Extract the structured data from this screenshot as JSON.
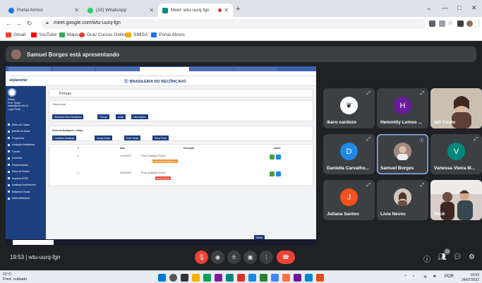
{
  "browser": {
    "tabs": [
      {
        "label": "Portal Atmos",
        "color": "#1a73e8"
      },
      {
        "label": "(10) WhatsApp",
        "color": "#25d366"
      },
      {
        "label": "Meet: wtu-uurq-fgn",
        "color": "#00897b"
      }
    ],
    "new_tab": "+",
    "window_controls": {
      "minimize": "—",
      "maximize": "□",
      "close": "✕"
    },
    "url": "meet.google.com/wtu-uurq-fgn",
    "bookmarks": [
      {
        "label": "Gmail",
        "color": "#ea4335"
      },
      {
        "label": "YouTube",
        "color": "#ff0000"
      },
      {
        "label": "Maps",
        "color": "#34a853"
      },
      {
        "label": "Grav Cursos Online...",
        "color": "#e53935"
      },
      {
        "label": "SIMSA",
        "color": "#f9ab00"
      },
      {
        "label": "Portal Atmos",
        "color": "#1a73e8"
      }
    ]
  },
  "meet": {
    "presenter_text": "Samuel Borges está apresentando",
    "meeting_time": "19:53",
    "meeting_code": "wtu-uurq-fgn",
    "participants_count": "10",
    "tiles": [
      {
        "name": "ikaro cardozo",
        "initial": "",
        "color": "#ffffff",
        "kind": "image"
      },
      {
        "name": "Hemmilly Lemos ...",
        "initial": "H",
        "color": "#6a1b9a",
        "kind": "initial"
      },
      {
        "name": "tati Couto",
        "initial": "",
        "color": "#c8b8a8",
        "kind": "video"
      },
      {
        "name": "Daniella Carvalho...",
        "initial": "D",
        "color": "#1e88e5",
        "kind": "initial"
      },
      {
        "name": "Samuel Borges",
        "initial": "",
        "color": "#9aa0a6",
        "kind": "image"
      },
      {
        "name": "Vanessa Vieira M...",
        "initial": "V",
        "color": "#00897b",
        "kind": "initial"
      },
      {
        "name": "Juliana Santos",
        "initial": "J",
        "color": "#f4511e",
        "kind": "initial"
      },
      {
        "name": "Livia Neves",
        "initial": "",
        "color": "#b0a090",
        "kind": "image"
      },
      {
        "name": "Você",
        "initial": "",
        "color": "#d7ccc8",
        "kind": "video"
      }
    ]
  },
  "shared_screen": {
    "logo": "siplanetar",
    "brand": "BRASILEIRA DO RECÔNCAVO",
    "user": {
      "name": "Rafael",
      "line2": "Prof. Titular",
      "email": "rafael@ufrb.edu.br",
      "line4": "Login Perfil"
    },
    "menu": [
      "Diário de Classe",
      "Boletim de Aluno",
      "Frequência",
      "Avaliação Acadêmica",
      "Turmas",
      "Docentes",
      "Requerimentos",
      "Plano de Ensino",
      "Arquivos (PDF)",
      "Avaliação Institucional",
      "Biblioteca Virtual",
      "Minha Biblioteca"
    ],
    "page_title": "Provas",
    "course_line": "Farmacologia",
    "buttons_top": [
      "Selecionar Dos Estudantes",
      "Turmas",
      "Aulas",
      "Informações"
    ],
    "section_title": "Prova de Avaliações e Notas",
    "buttons_mid": [
      "Cadastrar Avaliação",
      "Lançar Notas",
      "Exibir Notas",
      "Gerar Ficha"
    ],
    "table_headers": [
      "#",
      "Data",
      "Descrição",
      "Ações"
    ],
    "rows": [
      {
        "n": "1",
        "date": "17/03/2022",
        "desc": "Prova: Avaliação Prática",
        "tag": "PERIODO ENCERRADO"
      },
      {
        "n": "2",
        "date": "24/03/2022",
        "desc": "Prova: Avaliação Teórica",
        "tag": "PRAZO PELO"
      }
    ],
    "footer_button": "Salvar"
  },
  "windows": {
    "weather_temp": "21°C",
    "weather_desc": "Pred. nublado",
    "lang": "POR",
    "time": "19:53",
    "date": "24/07/2022"
  }
}
